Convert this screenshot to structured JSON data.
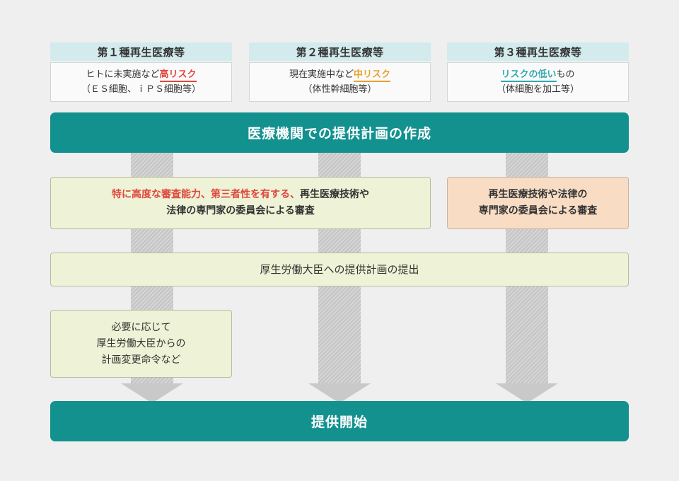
{
  "categories": [
    {
      "title": "第１種再生医療等",
      "line1_prefix": "ヒトに未実施など",
      "line1_highlight": "高リスク",
      "line1_suffix": "",
      "line2": "（ＥＳ細胞、ｉＰＳ細胞等）"
    },
    {
      "title": "第２種再生医療等",
      "line1_prefix": "現在実施中など",
      "line1_highlight": "中リスク",
      "line1_suffix": "",
      "line2": "（体性幹細胞等）"
    },
    {
      "title": "第３種再生医療等",
      "line1_prefix": "",
      "line1_highlight": "リスクの低い",
      "line1_suffix": "もの",
      "line2": "（体細胞を加工等）"
    }
  ],
  "plan_bar": "医療機関での提供計画の作成",
  "review_specific": {
    "highlight": "特に高度な審査能力、第三者性を有する、",
    "rest_line1": "再生医療技術や",
    "line2": "法律の専門家の委員会による審査"
  },
  "review_cat3": {
    "line1": "再生医療技術や法律の",
    "line2": "専門家の委員会による審査"
  },
  "submit_bar": "厚生労働大臣への提供計画の提出",
  "order_box": {
    "line1": "必要に応じて",
    "line2": "厚生労働大臣からの",
    "line3": "計画変更命令など"
  },
  "start_bar": "提供開始",
  "colors": {
    "teal": "#12918f",
    "header": "#d3ebec",
    "green_box": "#eef2d6",
    "peach_box": "#f8ddc4",
    "high_risk": "#e0463c",
    "mid_risk": "#e8a02a",
    "low_risk": "#2fa7ae"
  }
}
